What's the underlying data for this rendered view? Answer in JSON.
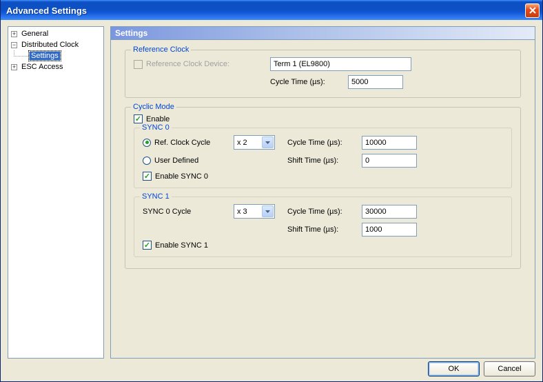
{
  "window": {
    "title": "Advanced Settings"
  },
  "tree": {
    "general": "General",
    "distributed_clock": "Distributed Clock",
    "settings": "Settings",
    "esc_access": "ESC Access"
  },
  "panel_header": "Settings",
  "ref_clock": {
    "legend": "Reference Clock",
    "device_label": "Reference Clock Device:",
    "device_value": "Term 1 (EL9800)",
    "cycle_label": "Cycle Time (µs):",
    "cycle_value": "5000"
  },
  "cyclic": {
    "legend": "Cyclic Mode",
    "enable_label": "Enable"
  },
  "sync0": {
    "legend": "SYNC 0",
    "ref_clock_cycle_label": "Ref. Clock Cycle",
    "multiplier": "x 2",
    "user_defined_label": "User Defined",
    "cycle_label": "Cycle Time (µs):",
    "cycle_value": "10000",
    "shift_label": "Shift Time (µs):",
    "shift_value": "0",
    "enable_label": "Enable SYNC 0"
  },
  "sync1": {
    "legend": "SYNC 1",
    "sync0_cycle_label": "SYNC 0 Cycle",
    "multiplier": "x 3",
    "cycle_label": "Cycle Time (µs):",
    "cycle_value": "30000",
    "shift_label": "Shift Time (µs):",
    "shift_value": "1000",
    "enable_label": "Enable SYNC 1"
  },
  "buttons": {
    "ok": "OK",
    "cancel": "Cancel"
  }
}
